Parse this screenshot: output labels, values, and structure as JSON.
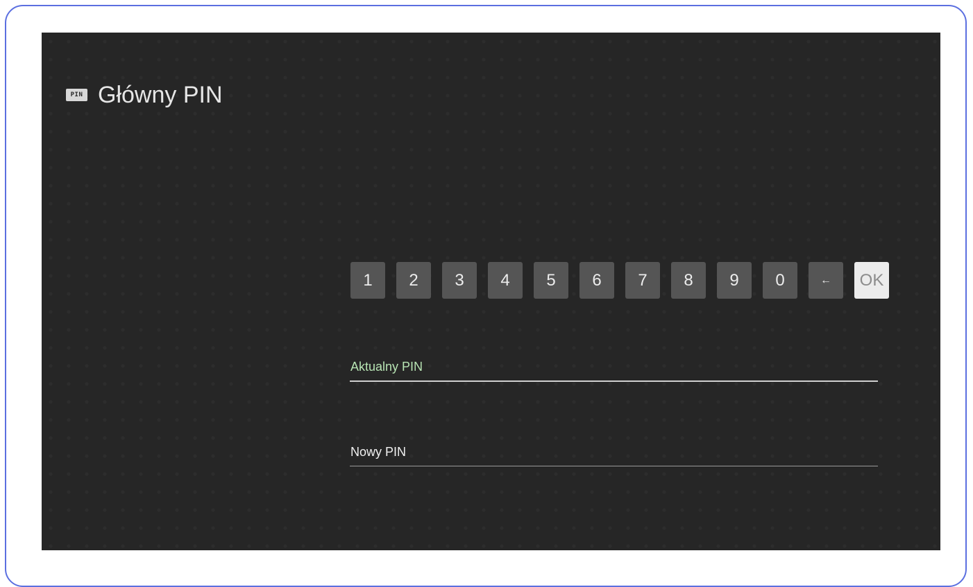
{
  "header": {
    "icon": "pin-icon",
    "icon_text": "PIN",
    "title": "Główny PIN"
  },
  "keypad": {
    "keys": [
      {
        "label": "1",
        "name": "key-1"
      },
      {
        "label": "2",
        "name": "key-2"
      },
      {
        "label": "3",
        "name": "key-3"
      },
      {
        "label": "4",
        "name": "key-4"
      },
      {
        "label": "5",
        "name": "key-5"
      },
      {
        "label": "6",
        "name": "key-6"
      },
      {
        "label": "7",
        "name": "key-7"
      },
      {
        "label": "8",
        "name": "key-8"
      },
      {
        "label": "9",
        "name": "key-9"
      },
      {
        "label": "0",
        "name": "key-0"
      },
      {
        "label": "←",
        "name": "key-backspace"
      },
      {
        "label": "OK",
        "name": "key-ok"
      }
    ],
    "focused_key": "OK"
  },
  "fields": {
    "current_pin_label": "Aktualny PIN",
    "new_pin_label": "Nowy PIN"
  },
  "colors": {
    "accent_label": "#b7e4b3",
    "frame_border": "#5b6fe0",
    "screen_bg": "#262626"
  }
}
